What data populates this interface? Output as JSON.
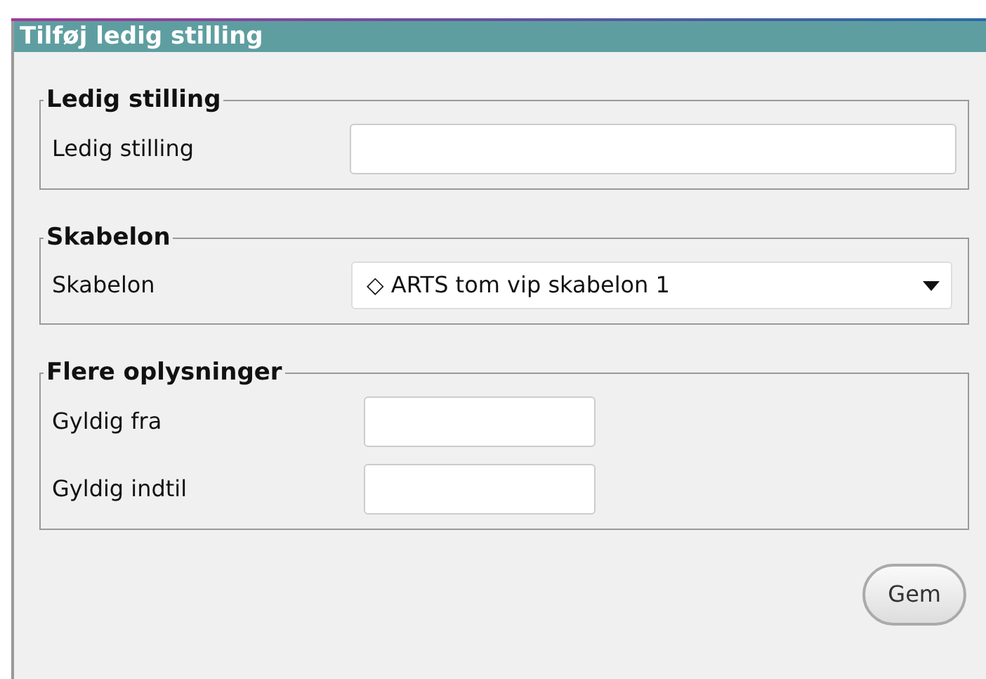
{
  "panel": {
    "title": "Tilføj ledig stilling"
  },
  "sections": [
    {
      "legend": "Ledig stilling",
      "fields": [
        {
          "kind": "text",
          "label": "Ledig stilling"
        }
      ]
    },
    {
      "legend": "Skabelon",
      "fields": [
        {
          "kind": "select",
          "label": "Skabelon",
          "value": "◇ ARTS tom vip skabelon 1"
        }
      ]
    },
    {
      "legend": "Flere oplysninger",
      "fields": [
        {
          "kind": "date",
          "label": "Gyldig fra"
        },
        {
          "kind": "date",
          "label": "Gyldig indtil"
        }
      ]
    }
  ],
  "buttons": [
    "Gem"
  ]
}
